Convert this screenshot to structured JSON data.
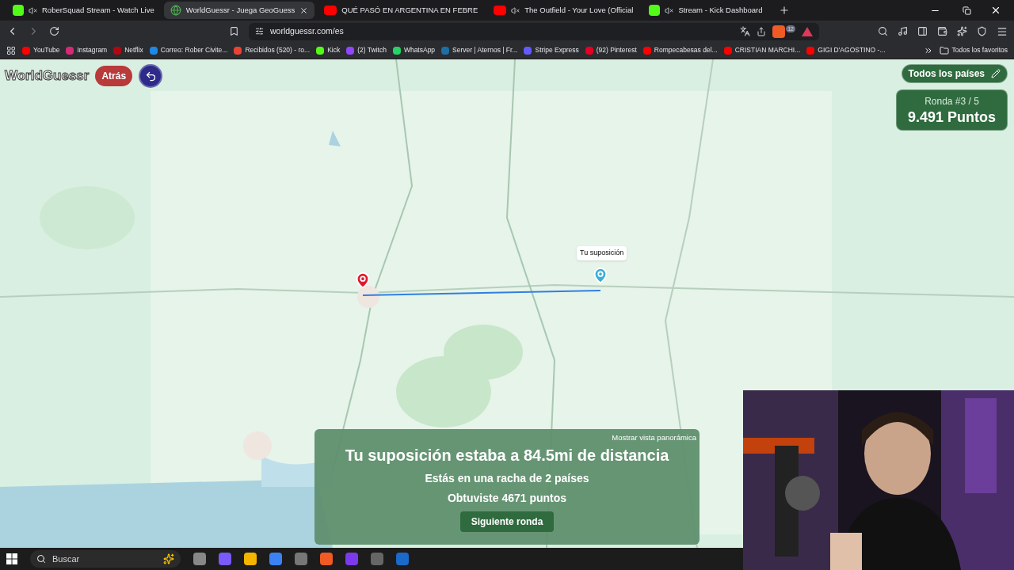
{
  "tabs": [
    {
      "title": "RoberSquad Stream - Watch Live",
      "kind": "kick",
      "muted": true,
      "selected": false
    },
    {
      "title": "WorldGuessr - Juega GeoGuess",
      "kind": "globe",
      "muted": false,
      "selected": true
    },
    {
      "title": "QUÉ PASÓ EN ARGENTINA EN FEBRE",
      "kind": "youtube",
      "muted": false,
      "selected": false
    },
    {
      "title": "The Outfield - Your Love (Official",
      "kind": "youtube",
      "muted": true,
      "selected": false
    },
    {
      "title": "Stream - Kick Dashboard",
      "kind": "kick",
      "muted": true,
      "selected": false
    }
  ],
  "address": "worldguessr.com/es",
  "shield_count": "12",
  "bookmarks": [
    {
      "label": "YouTube",
      "color": "#ff0000"
    },
    {
      "label": "Instagram",
      "color": "#d62976"
    },
    {
      "label": "Netflix",
      "color": "#b20710"
    },
    {
      "label": "Correo: Rober Civite...",
      "color": "#1e88e5"
    },
    {
      "label": "Recibidos (520) - ro...",
      "color": "#ea4335"
    },
    {
      "label": "Kick",
      "color": "#53fc18"
    },
    {
      "label": "(2) Twitch",
      "color": "#9146ff"
    },
    {
      "label": "WhatsApp",
      "color": "#25d366"
    },
    {
      "label": "Server | Aternos | Fr...",
      "color": "#1d6fa5"
    },
    {
      "label": "Stripe Express",
      "color": "#635bff"
    },
    {
      "label": "(92) Pinterest",
      "color": "#e60023"
    },
    {
      "label": "Rompecabesas del...",
      "color": "#ff0000"
    },
    {
      "label": "CRISTIAN MARCHI...",
      "color": "#ff0000"
    },
    {
      "label": "GIGI D'AGOSTINO -...",
      "color": "#ff0000"
    }
  ],
  "all_bookmarks": "Todos los favoritos",
  "game": {
    "logo": "WorldGuessr",
    "back_button": "Atrás",
    "mode_button": "Todos los países",
    "round": "Ronda #3 / 5",
    "points": "9.491 Puntos",
    "guess_label": "Tu suposición",
    "result": {
      "panorama_link": "Mostrar vista panorámica",
      "distance": "Tu suposición estaba a 84.5mi de distancia",
      "streak": "Estás en una racha de 2 países",
      "earned": "Obtuviste 4671 puntos",
      "next_button": "Siguiente ronda"
    }
  },
  "taskbar": {
    "search": "Buscar"
  }
}
